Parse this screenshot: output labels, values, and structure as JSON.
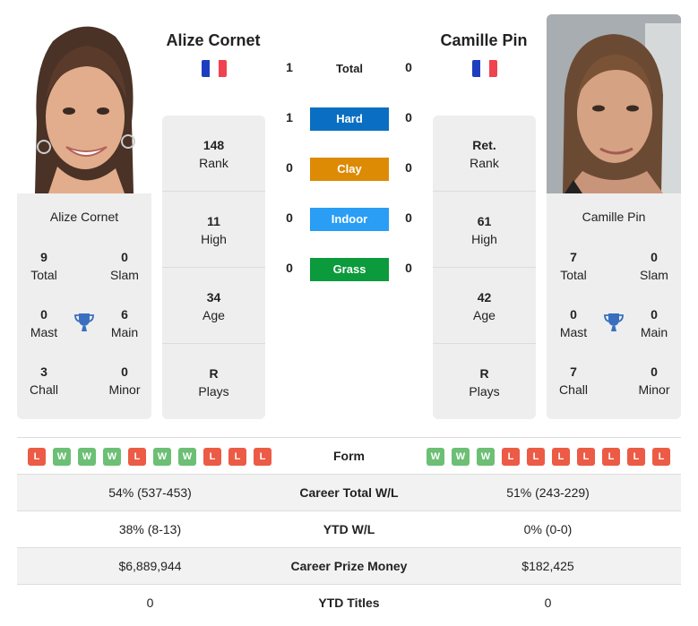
{
  "colors": {
    "hard": "#0a6fc2",
    "clay": "#dd8a05",
    "indoor": "#2a9df4",
    "grass": "#0b9a3c",
    "win": "#6cbf74",
    "loss": "#ec5b45",
    "trophy": "#3a6fc0"
  },
  "player1": {
    "name": "Alize Cornet",
    "country_flag": "france-flag",
    "photo": "player-photo",
    "rank": {
      "value": "148",
      "label": "Rank"
    },
    "high": {
      "value": "11",
      "label": "High"
    },
    "age": {
      "value": "34",
      "label": "Age"
    },
    "plays": {
      "value": "R",
      "label": "Plays"
    },
    "titles": {
      "total": {
        "value": "9",
        "label": "Total"
      },
      "slam": {
        "value": "0",
        "label": "Slam"
      },
      "mast": {
        "value": "0",
        "label": "Mast"
      },
      "main": {
        "value": "6",
        "label": "Main"
      },
      "chall": {
        "value": "3",
        "label": "Chall"
      },
      "minor": {
        "value": "0",
        "label": "Minor"
      }
    },
    "form": [
      "L",
      "W",
      "W",
      "W",
      "L",
      "W",
      "W",
      "L",
      "L",
      "L"
    ]
  },
  "player2": {
    "name": "Camille Pin",
    "country_flag": "france-flag",
    "photo": "player-photo",
    "rank": {
      "value": "Ret.",
      "label": "Rank"
    },
    "high": {
      "value": "61",
      "label": "High"
    },
    "age": {
      "value": "42",
      "label": "Age"
    },
    "plays": {
      "value": "R",
      "label": "Plays"
    },
    "titles": {
      "total": {
        "value": "7",
        "label": "Total"
      },
      "slam": {
        "value": "0",
        "label": "Slam"
      },
      "mast": {
        "value": "0",
        "label": "Mast"
      },
      "main": {
        "value": "0",
        "label": "Main"
      },
      "chall": {
        "value": "7",
        "label": "Chall"
      },
      "minor": {
        "value": "0",
        "label": "Minor"
      }
    },
    "form": [
      "W",
      "W",
      "W",
      "L",
      "L",
      "L",
      "L",
      "L",
      "L",
      "L"
    ]
  },
  "h2h": {
    "total": {
      "label": "Total",
      "p1": "1",
      "p2": "0"
    },
    "hard": {
      "label": "Hard",
      "p1": "1",
      "p2": "0"
    },
    "clay": {
      "label": "Clay",
      "p1": "0",
      "p2": "0"
    },
    "indoor": {
      "label": "Indoor",
      "p1": "0",
      "p2": "0"
    },
    "grass": {
      "label": "Grass",
      "p1": "0",
      "p2": "0"
    }
  },
  "table": {
    "form_label": "Form",
    "rows": [
      {
        "label": "Career Total W/L",
        "p1": "54% (537-453)",
        "p2": "51% (243-229)"
      },
      {
        "label": "YTD W/L",
        "p1": "38% (8-13)",
        "p2": "0% (0-0)"
      },
      {
        "label": "Career Prize Money",
        "p1": "$6,889,944",
        "p2": "$182,425"
      },
      {
        "label": "YTD Titles",
        "p1": "0",
        "p2": "0"
      }
    ]
  }
}
